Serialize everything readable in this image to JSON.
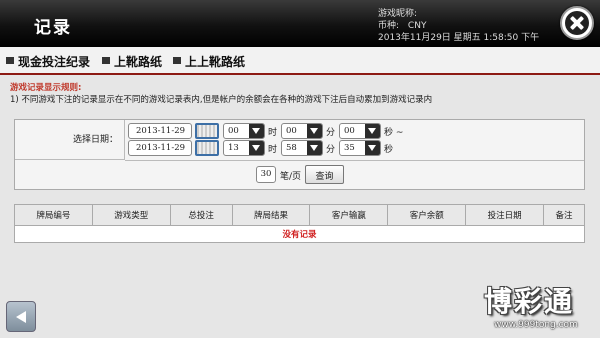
{
  "header": {
    "title": "记录",
    "account": {
      "nickname_label": "游戏昵称:",
      "currency_label": "币种:",
      "currency_value": "CNY",
      "datetime": "2013年11月29日 星期五 1:58:50 下午"
    }
  },
  "nav": {
    "items": [
      {
        "label": "现金投注纪录"
      },
      {
        "label": "上靴路纸"
      },
      {
        "label": "上上靴路纸"
      }
    ]
  },
  "rules": {
    "title": "游戏记录显示规则:",
    "text": "1) 不同游戏下注的记录显示在不同的游戏记录表内,但是帐户的余额会在各种的游戏下注后自动累加到游戏记录内"
  },
  "filter": {
    "date_label": "选择日期：",
    "start": {
      "date": "2013-11-29",
      "hour": "00",
      "minute": "00",
      "second": "00"
    },
    "end": {
      "date": "2013-11-29",
      "hour": "13",
      "minute": "58",
      "second": "35"
    },
    "units": {
      "hour": "时",
      "minute": "分",
      "second": "秒",
      "range_sep": "秒 ~"
    },
    "page_size": "30",
    "per_page_label": "笔/页",
    "query_label": "查询"
  },
  "table": {
    "columns": [
      "牌局编号",
      "游戏类型",
      "总投注",
      "牌局结果",
      "客户输赢",
      "客户余额",
      "投注日期",
      "备注"
    ],
    "empty_message": "没有记录"
  },
  "watermark": {
    "logo": "博彩通",
    "url": "www.999tong.com"
  },
  "colors": {
    "header_bg": "#000000",
    "accent_red": "#8d1a14",
    "rules_title": "#c0392b",
    "empty_text": "#d01f1f",
    "calendar_border": "#3d6fa6"
  }
}
